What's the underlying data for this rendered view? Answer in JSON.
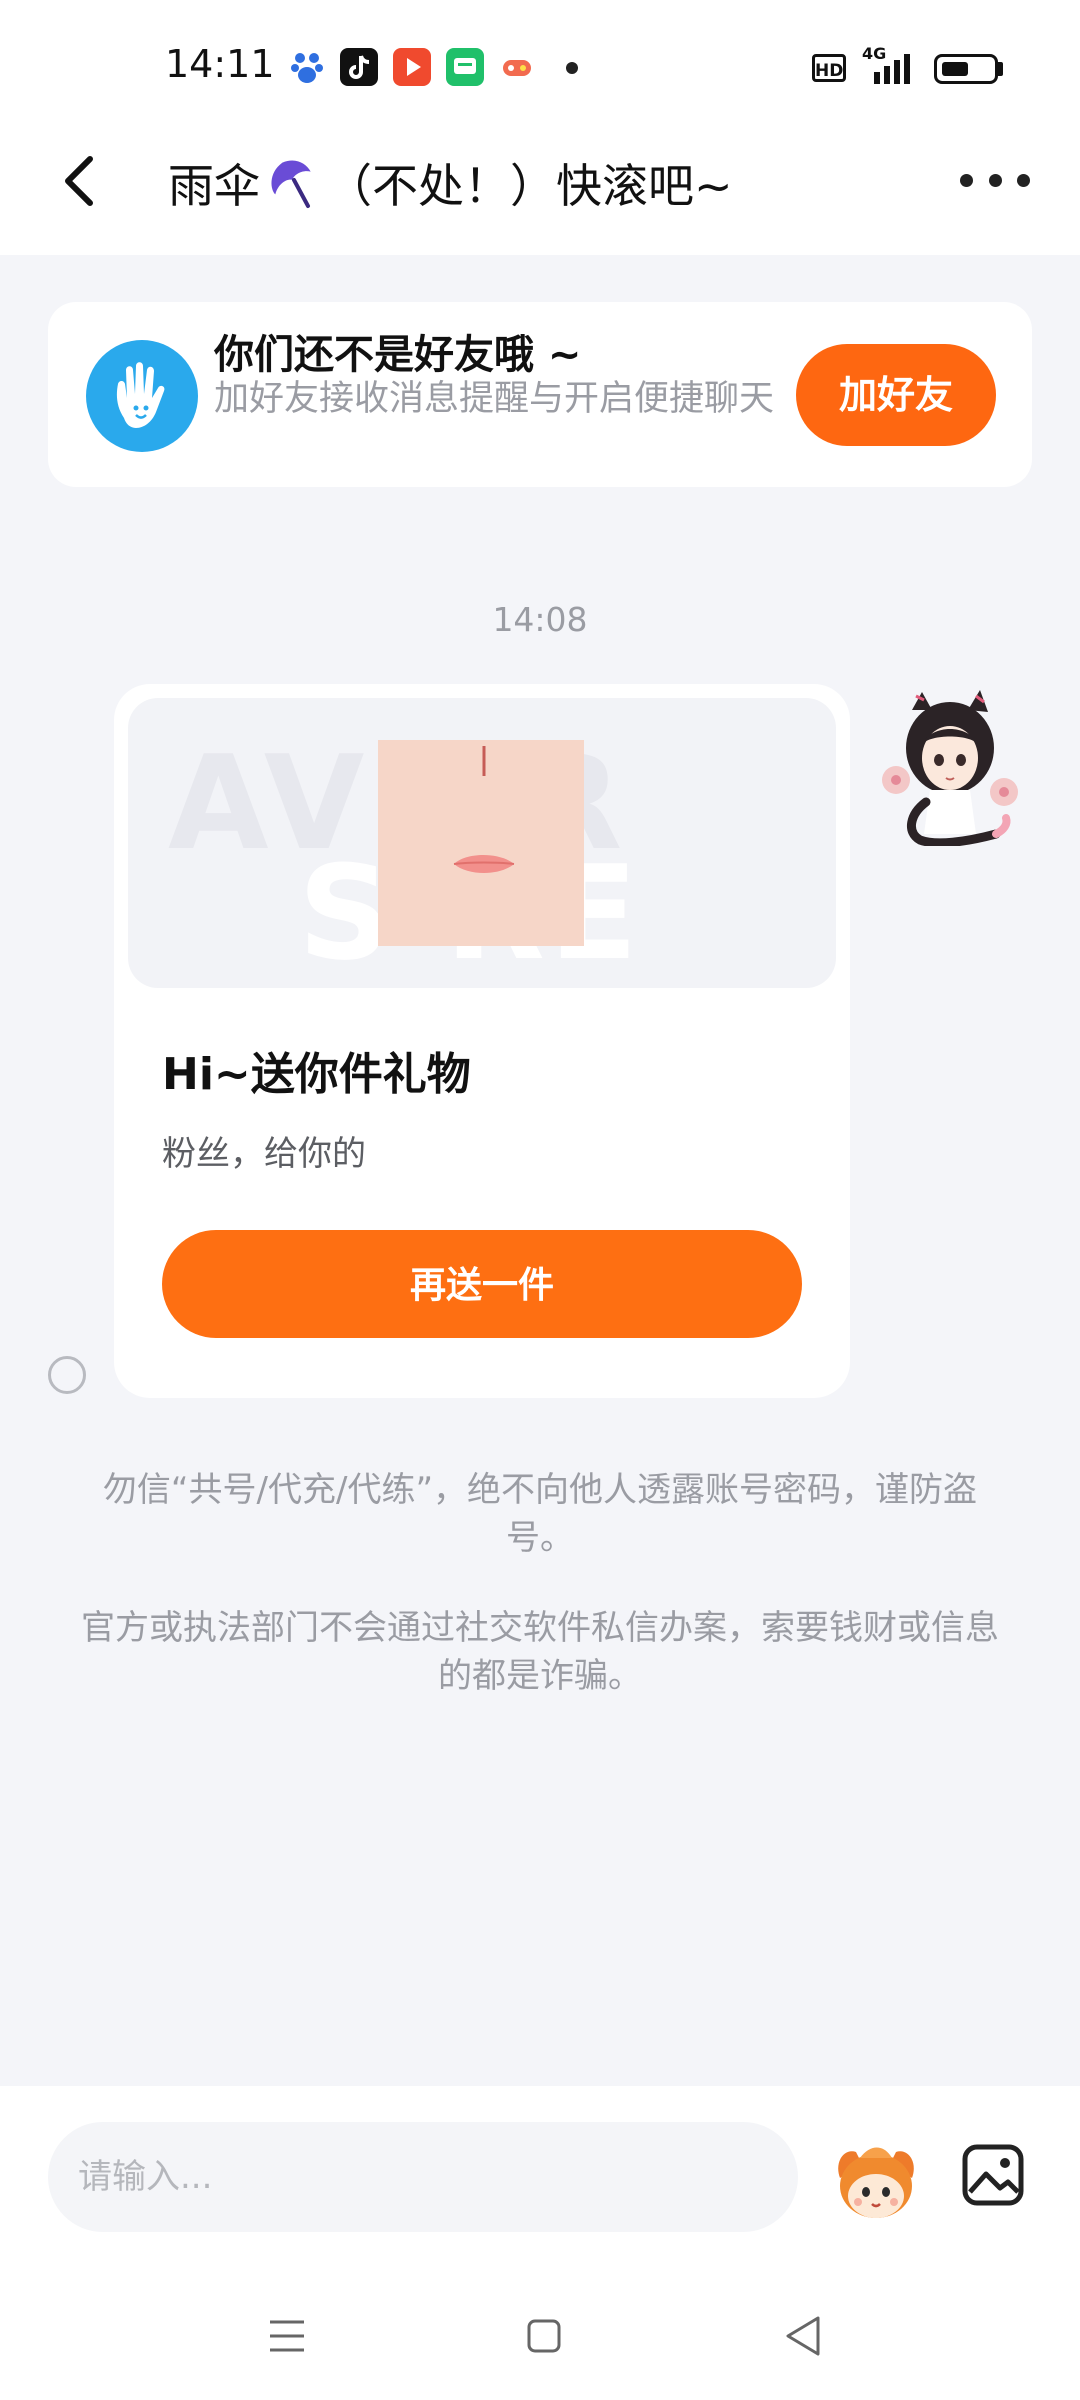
{
  "status_bar": {
    "time": "14:11",
    "app_icons": [
      "baidu-map-icon",
      "douyin-icon",
      "video-play-icon",
      "chat-app-icon",
      "game-icon"
    ],
    "hd_label": "HD",
    "network_label": "4G",
    "battery_level": 0.55
  },
  "header": {
    "title_before": "雨伞",
    "title_after": "（不处！）快滚吧~",
    "back_icon": "chevron-left-icon",
    "more_icon": "more-dots-icon"
  },
  "friend_card": {
    "title": "你们还不是好友哦 ~",
    "subtitle": "加好友接收消息提醒与开启便捷聊天",
    "add_button": "加好友"
  },
  "messages": {
    "timestamp": "14:08",
    "gift": {
      "title": "Hi~送你件礼物",
      "description": "粉丝，给你的",
      "button": "再送一件"
    }
  },
  "notices": [
    "勿信“共号/代充/代练”，绝不向他人透露账号密码，谨防盗号。",
    "官方或执法部门不会通过社交软件私信办案，索要钱财或信息的都是诈骗。"
  ],
  "input_bar": {
    "placeholder": "请输入..."
  },
  "colors": {
    "accent": "#fe6711",
    "background": "#f4f5f9",
    "muted_text": "#9a9ca3"
  }
}
